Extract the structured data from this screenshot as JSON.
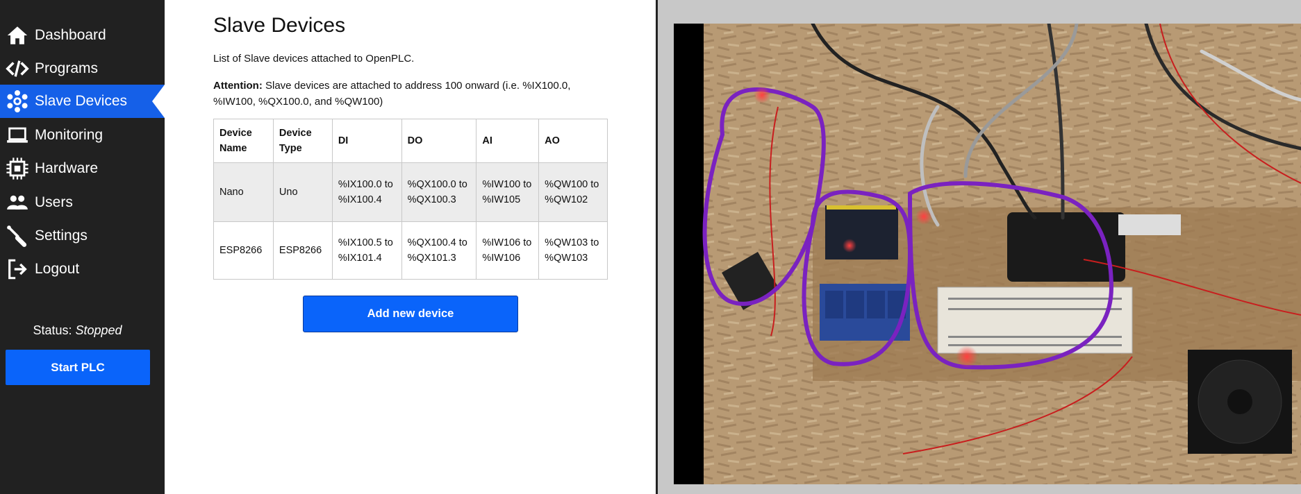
{
  "sidebar": {
    "items": [
      {
        "label": "Dashboard",
        "icon": "home-icon"
      },
      {
        "label": "Programs",
        "icon": "code-icon"
      },
      {
        "label": "Slave Devices",
        "icon": "gear-cog-icon",
        "active": true
      },
      {
        "label": "Monitoring",
        "icon": "laptop-icon"
      },
      {
        "label": "Hardware",
        "icon": "chip-icon"
      },
      {
        "label": "Users",
        "icon": "users-icon"
      },
      {
        "label": "Settings",
        "icon": "wrench-icon"
      },
      {
        "label": "Logout",
        "icon": "logout-icon"
      }
    ],
    "status_label": "Status:",
    "status_value": "Stopped",
    "start_button": "Start PLC"
  },
  "main": {
    "title": "Slave Devices",
    "description": "List of Slave devices attached to OpenPLC.",
    "attention_label": "Attention:",
    "attention_text": "Slave devices are attached to address 100 onward (i.e. %IX100.0, %IW100, %QX100.0, and %QW100)",
    "table": {
      "headers": [
        "Device Name",
        "Device Type",
        "DI",
        "DO",
        "AI",
        "AO"
      ],
      "rows": [
        [
          "Nano",
          "Uno",
          "%IX100.0 to %IX100.4",
          "%QX100.0 to %QX100.3",
          "%IW100 to %IW105",
          "%QW100 to %QW102"
        ],
        [
          "ESP8266",
          "ESP8266",
          "%IX100.5 to %IX101.4",
          "%QX100.4 to %QX101.3",
          "%IW106 to %IW106",
          "%QW103 to %QW103"
        ]
      ]
    },
    "add_button": "Add new device"
  },
  "colors": {
    "sidebar_bg": "#212121",
    "accent": "#0a64fa",
    "active_item": "#1560e8"
  }
}
